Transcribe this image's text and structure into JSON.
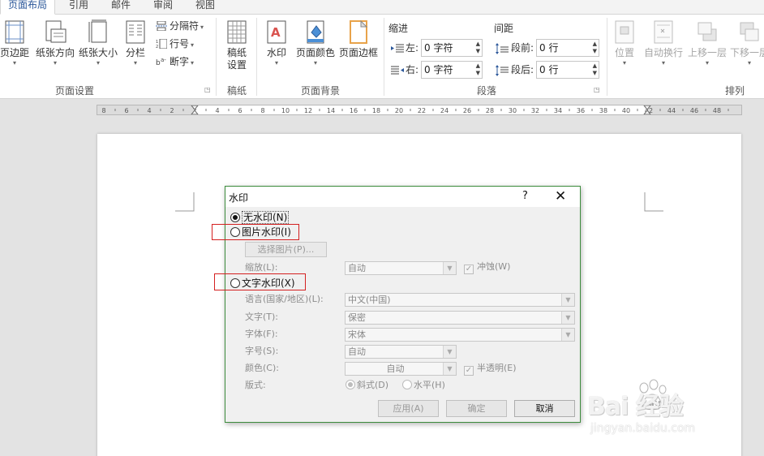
{
  "tabs": [
    "页面布局",
    "引用",
    "邮件",
    "审阅",
    "视图"
  ],
  "ribbon": {
    "page_setup": {
      "margins": "页边距",
      "orientation": "纸张方向",
      "size": "纸张大小",
      "columns": "分栏",
      "breaks": "分隔符",
      "line_numbers": "行号",
      "hyphenation": "断字",
      "label": "页面设置"
    },
    "paper": {
      "settings_line1": "稿纸",
      "settings_line2": "设置",
      "label": "稿纸"
    },
    "background": {
      "watermark": "水印",
      "page_color": "页面颜色",
      "page_borders": "页面边框",
      "label": "页面背景"
    },
    "paragraph": {
      "indent_head": "缩进",
      "left_label": "左:",
      "left_value": "0 字符",
      "right_label": "右:",
      "right_value": "0 字符",
      "spacing_head": "间距",
      "before_label": "段前:",
      "before_value": "0 行",
      "after_label": "段后:",
      "after_value": "0 行",
      "label": "段落"
    },
    "arrange": {
      "position": "位置",
      "wrap_text": "自动换行",
      "bring_forward": "上移一层",
      "send_backward": "下移一层",
      "label": "排列"
    }
  },
  "ruler": {
    "ticks": [
      "8",
      "6",
      "4",
      "2",
      "2",
      "4",
      "6",
      "8",
      "10",
      "12",
      "14",
      "16",
      "18",
      "20",
      "22",
      "24",
      "26",
      "28",
      "30",
      "32",
      "34",
      "36",
      "38",
      "40",
      "42",
      "44",
      "46",
      "48"
    ]
  },
  "dialog": {
    "title": "水印",
    "help": "?",
    "close": "✕",
    "no_watermark": "无水印(N)",
    "picture_watermark": "图片水印(I)",
    "select_picture": "选择图片(P)...",
    "scale_label": "缩放(L):",
    "scale_value": "自动",
    "washout": "冲蚀(W)",
    "text_watermark": "文字水印(X)",
    "language_label": "语言(国家/地区)(L):",
    "language_value": "中文(中国)",
    "text_label": "文字(T):",
    "text_value": "保密",
    "font_label": "字体(F):",
    "font_value": "宋体",
    "size_label": "字号(S):",
    "size_value": "自动",
    "color_label": "颜色(C):",
    "color_value": "自动",
    "semitransparent": "半透明(E)",
    "layout_label": "版式:",
    "diagonal": "斜式(D)",
    "horizontal": "水平(H)",
    "apply": "应用(A)",
    "ok": "确定",
    "cancel": "取消"
  },
  "watermark_overlay": {
    "brand": "Bai  经验",
    "url": "jingyan.baidu.com"
  }
}
